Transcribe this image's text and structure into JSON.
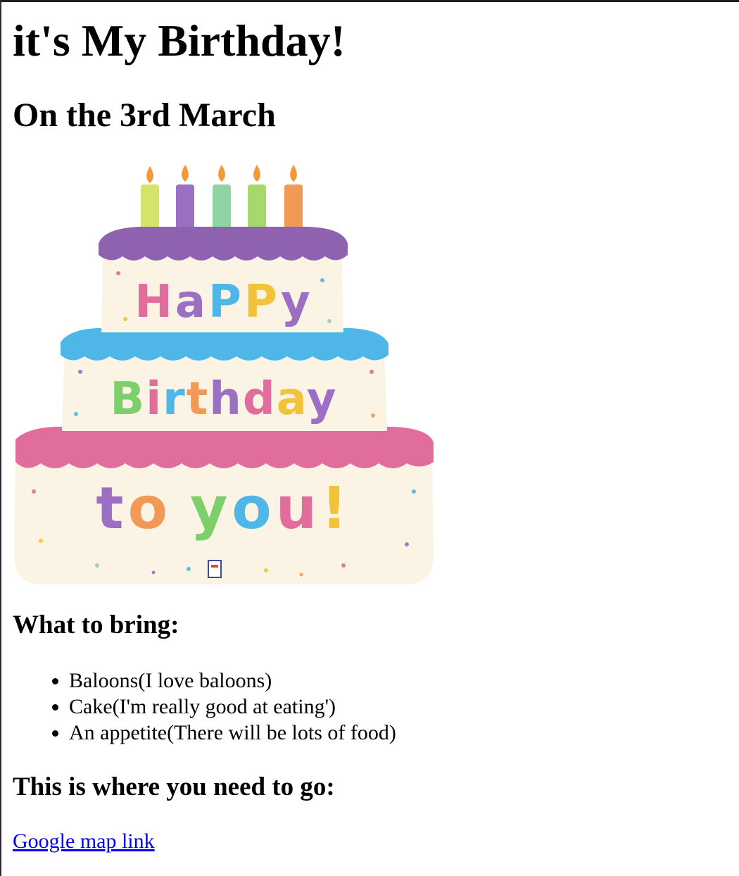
{
  "page": {
    "title": "it's My Birthday!",
    "date_heading": "On the 3rd March"
  },
  "cake_image": {
    "icon": "birthday-cake-balloon-image",
    "line1": "HaPPy",
    "line2": "Birthday",
    "line3": "to you!",
    "colors": {
      "top_frosting": "#8e62ae",
      "middle_frosting": "#4fb6e8",
      "bottom_frosting": "#e06d9c",
      "cake_body": "#fbf3e4"
    }
  },
  "bring_section": {
    "heading": "What to bring:",
    "items": [
      "Baloons(I love baloons)",
      "Cake(I'm really good at eating')",
      "An appetite(There will be lots of food)"
    ]
  },
  "location_section": {
    "heading": "This is where you need to go:",
    "link_text": "Google map link"
  }
}
